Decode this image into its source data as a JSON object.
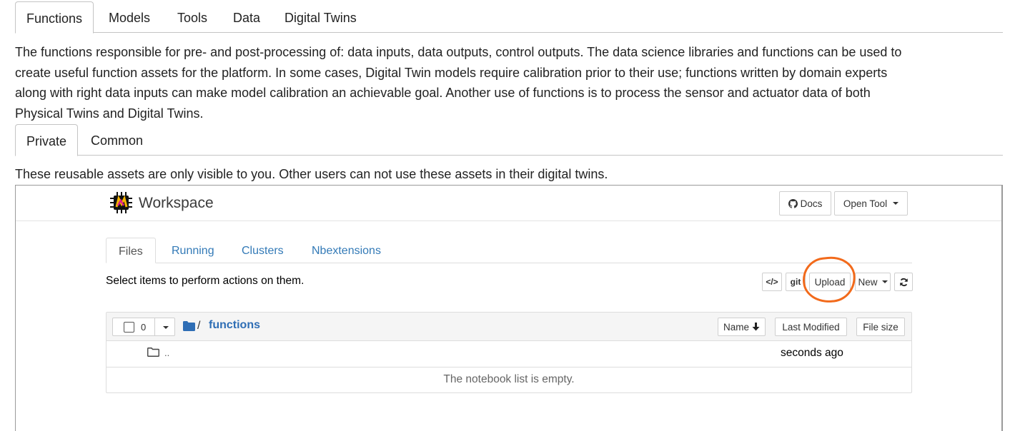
{
  "top_tabs": [
    "Functions",
    "Models",
    "Tools",
    "Data",
    "Digital Twins"
  ],
  "description_lines": [
    "The functions responsible for pre- and post-processing of: data inputs, data outputs, control outputs. The data science libraries and functions can be used to",
    "create useful function assets for the platform. In some cases, Digital Twin models require calibration prior to their use; functions written by domain experts",
    "along with right data inputs can make model calibration an achievable goal. Another use of functions is to process the sensor and actuator data of both",
    "Physical Twins and Digital Twins."
  ],
  "sub_tabs": [
    "Private",
    "Common"
  ],
  "private_note": "These reusable assets are only visible to you. Other users can not use these assets in their digital twins.",
  "workspace": {
    "title": "Workspace",
    "docs_label": "Docs",
    "open_tool_label": "Open Tool",
    "tabs": [
      "Files",
      "Running",
      "Clusters",
      "Nbextensions"
    ],
    "select_hint": "Select items to perform actions on them.",
    "toolbar": {
      "code_label": "</>",
      "git_label": "git",
      "upload_label": "Upload",
      "new_label": "New",
      "refresh_icon": "refresh-icon"
    },
    "annotation_color": "#f26a1b",
    "list": {
      "selected_count": "0",
      "path_separator": "/",
      "current_dir": "functions",
      "sort_name": "Name",
      "sort_modified": "Last Modified",
      "sort_size": "File size",
      "parent_name": "..",
      "parent_modified": "seconds ago",
      "empty_message": "The notebook list is empty."
    }
  }
}
